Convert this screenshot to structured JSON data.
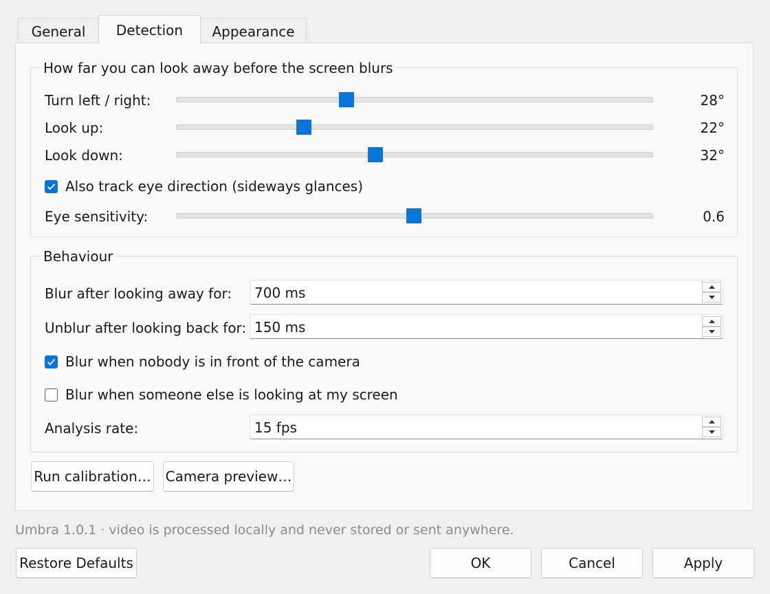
{
  "tabs": [
    {
      "label": "General"
    },
    {
      "label": "Detection"
    },
    {
      "label": "Appearance"
    }
  ],
  "active_tab": "Detection",
  "look_away_group": {
    "title": "How far you can look away before the screen blurs",
    "sliders": [
      {
        "label": "Turn left / right:",
        "value_text": "28°",
        "fraction": 0.358
      },
      {
        "label": "Look up:",
        "value_text": "22°",
        "fraction": 0.268
      },
      {
        "label": "Look down:",
        "value_text": "32°",
        "fraction": 0.418
      }
    ],
    "eye_tracking": {
      "label": "Also track eye direction (sideways glances)",
      "checked": true
    },
    "eye_sensitivity": {
      "label": "Eye sensitivity:",
      "value_text": "0.6",
      "fraction": 0.498
    }
  },
  "behaviour_group": {
    "title": "Behaviour",
    "blur_after": {
      "label": "Blur after looking away for:",
      "value": "700 ms"
    },
    "unblur_after": {
      "label": "Unblur after looking back for:",
      "value": "150 ms"
    },
    "blur_nobody": {
      "label": "Blur when nobody is in front of the camera",
      "checked": true
    },
    "blur_someone": {
      "label": "Blur when someone else is looking at my screen",
      "checked": false
    },
    "analysis_rate": {
      "label": "Analysis rate:",
      "value": "15 fps"
    }
  },
  "panel_buttons": {
    "run_calibration": "Run calibration…",
    "camera_preview": "Camera preview…"
  },
  "footer_note": "Umbra 1.0.1 · video is processed locally and never stored or sent anywhere.",
  "dialog_buttons": {
    "restore_defaults": "Restore Defaults",
    "ok": "OK",
    "cancel": "Cancel",
    "apply": "Apply"
  },
  "colors": {
    "accent": "#0a74d9",
    "muted_text": "#8b8b8b"
  }
}
